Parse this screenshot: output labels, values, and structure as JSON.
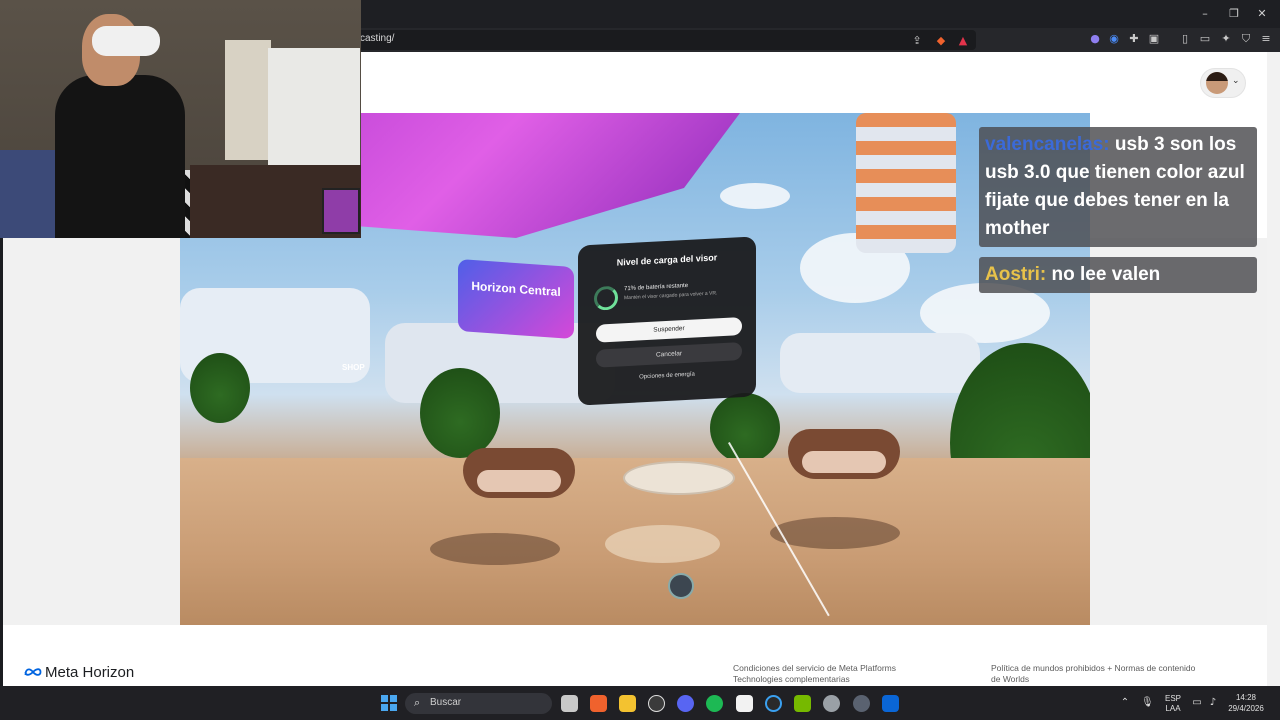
{
  "browser": {
    "url": "casting/",
    "window_controls": {
      "minimize": "–",
      "restore": "❐",
      "close": "✕"
    }
  },
  "vr_dialog": {
    "title": "Nivel de carga del visor",
    "battery_percent": "71% de batería restante",
    "battery_hint": "Mantén el visor cargado para volver a VR.",
    "primary_button": "Suspender",
    "secondary_button": "Cancelar",
    "link": "Opciones de energía",
    "battery_level": 0.71
  },
  "vr_scene": {
    "sign_text": "Horizon Central",
    "shop_text": "SHOP"
  },
  "chat": [
    {
      "user": "valencanelas:",
      "message": "usb 3 son los usb 3.0 que tienen color azul fijate que debes tener en la mother",
      "user_color": "#3b6ad8"
    },
    {
      "user": "Aostri:",
      "message": "no lee valen",
      "user_color": "#e8c24a"
    }
  ],
  "footer": {
    "logo_text": "Meta Horizon",
    "links_col1": [
      "Condiciones del servicio de Meta Platforms",
      "Technologies complementarias"
    ],
    "links_col2": [
      "Política de mundos prohibidos + Normas de contenido",
      "de Worlds"
    ]
  },
  "taskbar": {
    "search_placeholder": "Buscar",
    "language": "ESP",
    "keyboard": "LAA",
    "time": "14:28",
    "date": "29/4/2026"
  }
}
